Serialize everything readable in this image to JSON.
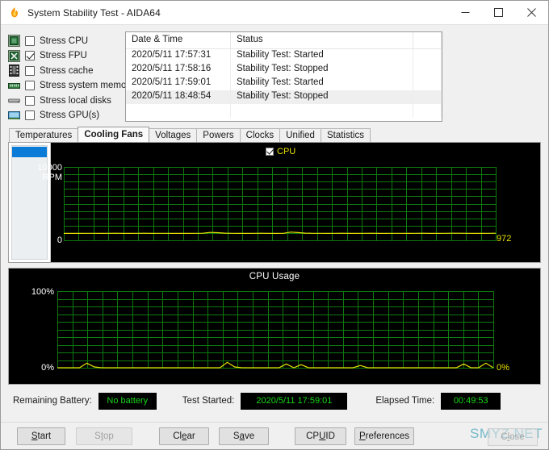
{
  "window": {
    "title": "System Stability Test - AIDA64",
    "icon": "flame-icon",
    "controls": {
      "minimize": "minimize-icon",
      "maximize": "maximize-icon",
      "close": "close-icon"
    }
  },
  "stress": {
    "items": [
      {
        "icon": "cpu-chip-icon",
        "label": "Stress CPU",
        "checked": false
      },
      {
        "icon": "fpu-chip-icon",
        "label": "Stress FPU",
        "checked": true
      },
      {
        "icon": "cache-icon",
        "label": "Stress cache",
        "checked": false
      },
      {
        "icon": "memory-icon",
        "label": "Stress system memory",
        "checked": false
      },
      {
        "icon": "disk-icon",
        "label": "Stress local disks",
        "checked": false
      },
      {
        "icon": "gpu-icon",
        "label": "Stress GPU(s)",
        "checked": false
      }
    ]
  },
  "log": {
    "columns": [
      "Date & Time",
      "Status",
      ""
    ],
    "rows": [
      {
        "datetime": "2020/5/11 17:57:31",
        "status": "Stability Test: Started"
      },
      {
        "datetime": "2020/5/11 17:58:16",
        "status": "Stability Test: Stopped"
      },
      {
        "datetime": "2020/5/11 17:59:01",
        "status": "Stability Test: Started"
      },
      {
        "datetime": "2020/5/11 18:48:54",
        "status": "Stability Test: Stopped"
      }
    ]
  },
  "tabs": [
    {
      "label": "Temperatures",
      "active": false
    },
    {
      "label": "Cooling Fans",
      "active": true
    },
    {
      "label": "Voltages",
      "active": false
    },
    {
      "label": "Powers",
      "active": false
    },
    {
      "label": "Clocks",
      "active": false
    },
    {
      "label": "Unified",
      "active": false
    },
    {
      "label": "Statistics",
      "active": false
    }
  ],
  "charts": {
    "fan": {
      "legend_label": "CPU",
      "legend_checked": true,
      "y_top": "10000",
      "y_unit": "RPM",
      "y_bottom": "0",
      "current_value": "972"
    },
    "usage": {
      "title": "CPU Usage",
      "y_top": "100%",
      "y_bottom": "0%",
      "current_value": "0%"
    }
  },
  "status": {
    "battery_label": "Remaining Battery:",
    "battery_value": "No battery",
    "started_label": "Test Started:",
    "started_value": "2020/5/11 17:59:01",
    "elapsed_label": "Elapsed Time:",
    "elapsed_value": "00:49:53"
  },
  "buttons": {
    "start": "Start",
    "stop": "Stop",
    "clear": "Clear",
    "save": "Save",
    "cpuid": "CPUID",
    "preferences": "Preferences",
    "close": "Close"
  },
  "watermark": "SMYZ.NET",
  "colors": {
    "plot_background": "#000000",
    "grid": "#0f7a0f",
    "series": "#e8e000",
    "lcd_text": "#19d619",
    "selection": "#0a7bd6"
  },
  "chart_data": [
    {
      "type": "line",
      "title": "",
      "ylabel": "RPM",
      "ylim": [
        0,
        10000
      ],
      "yticks": [
        "0",
        "10000"
      ],
      "legend": [
        "CPU"
      ],
      "legend_position": "top-center",
      "grid": true,
      "end_label": "972",
      "series": [
        {
          "name": "CPU",
          "values": [
            950,
            955,
            948,
            960,
            952,
            946,
            958,
            965,
            950,
            944,
            955,
            962,
            948,
            952,
            958,
            946,
            950,
            944,
            960,
            972,
            1080,
            1040,
            975,
            960,
            950,
            948,
            956,
            962,
            950,
            944,
            958,
            1120,
            1060,
            980,
            960,
            952,
            948,
            955,
            962,
            950,
            946,
            958,
            965,
            950,
            944,
            952,
            960,
            948,
            955,
            962,
            950,
            946,
            958,
            965,
            972,
            960,
            950,
            948,
            955,
            972
          ]
        }
      ]
    },
    {
      "type": "line",
      "title": "CPU Usage",
      "ylabel": "%",
      "ylim": [
        0,
        100
      ],
      "yticks": [
        "0%",
        "100%"
      ],
      "grid": true,
      "end_label": "0%",
      "series": [
        {
          "name": "CPU Usage",
          "values": [
            0,
            0,
            0,
            0,
            6,
            1,
            0,
            0,
            0,
            0,
            0,
            0,
            0,
            0,
            0,
            0,
            0,
            0,
            0,
            0,
            0,
            0,
            0,
            7,
            1,
            0,
            0,
            0,
            0,
            0,
            0,
            5,
            0,
            4,
            0,
            0,
            0,
            0,
            0,
            0,
            0,
            3,
            0,
            0,
            0,
            0,
            0,
            0,
            0,
            0,
            0,
            0,
            0,
            0,
            0,
            5,
            0,
            0,
            6,
            0
          ]
        }
      ]
    }
  ]
}
